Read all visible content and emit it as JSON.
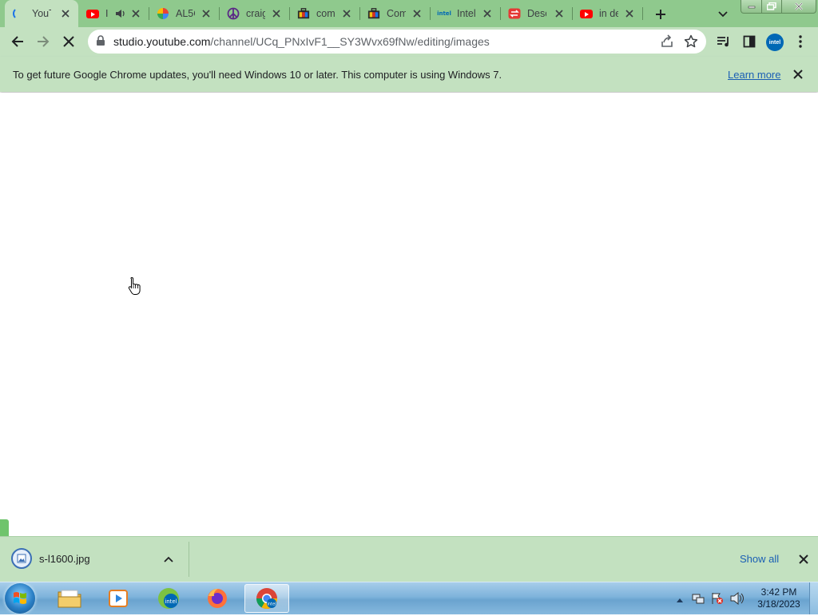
{
  "tabs": [
    {
      "title": "YouT",
      "icon": "loading-spinner-icon",
      "active": true
    },
    {
      "title": "I",
      "icon": "youtube-icon",
      "audio": true
    },
    {
      "title": "AL5C",
      "icon": "pinwheel-icon"
    },
    {
      "title": "craig",
      "icon": "peace-icon"
    },
    {
      "title": "com",
      "icon": "briefcase-icon"
    },
    {
      "title": "Com",
      "icon": "briefcase-icon"
    },
    {
      "title": "Intel",
      "icon": "intel-icon"
    },
    {
      "title": "Desc",
      "icon": "swap-icon"
    },
    {
      "title": "in de",
      "icon": "youtube-icon"
    }
  ],
  "address": {
    "host": "studio.youtube.com",
    "path": "/channel/UCq_PNxIvF1__SY3Wvx69fNw/editing/images"
  },
  "profile": {
    "label": "intel"
  },
  "infobar": {
    "message": "To get future Google Chrome updates, you'll need Windows 10 or later. This computer is using Windows 7.",
    "link": "Learn more"
  },
  "downloads": {
    "file": "s-l1600.jpg",
    "show_all": "Show all"
  },
  "taskbar": {
    "time": "3:42 PM",
    "date": "3/18/2023"
  },
  "colors": {
    "frame": "#8fc98d",
    "toolbar": "#c3e1c0",
    "link": "#1a5fb4"
  }
}
